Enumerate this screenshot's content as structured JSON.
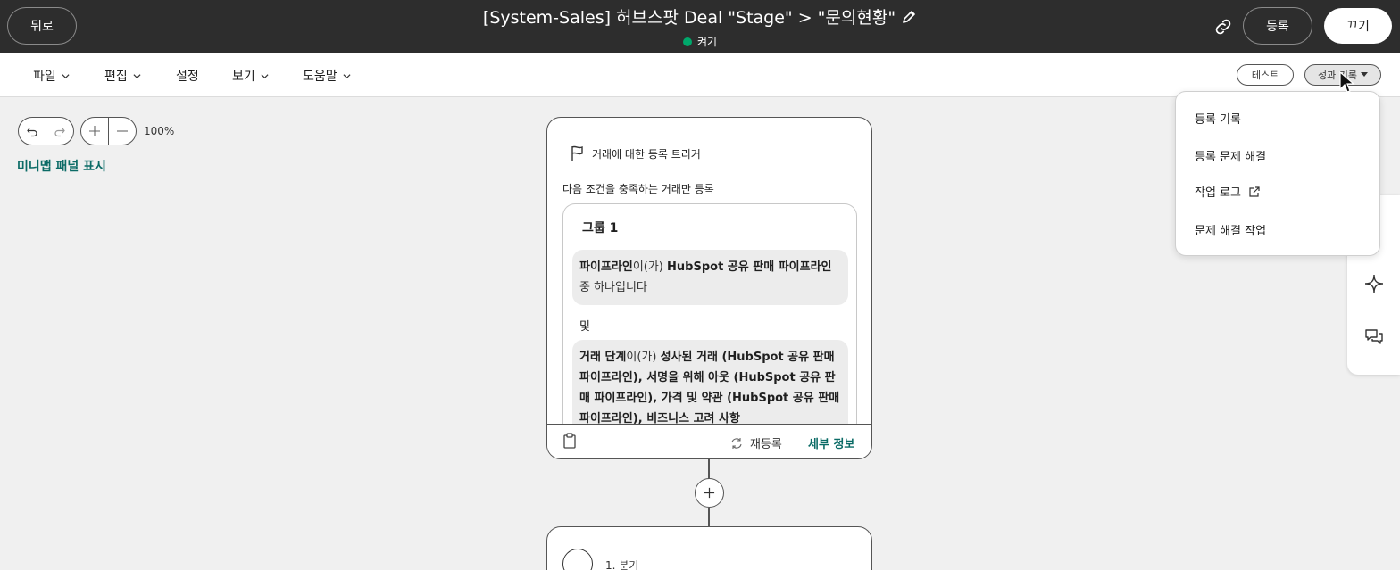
{
  "header": {
    "back_label": "뒤로",
    "title": "[System-Sales] 허브스팟 Deal \"Stage\" > \"문의현황\"",
    "status_text": "켜기",
    "status_color": "#00a86b",
    "register_label": "등록",
    "off_label": "끄기",
    "icons": {
      "edit": "pencil-icon",
      "link": "link-icon"
    }
  },
  "menubar": {
    "items": [
      {
        "label": "파일",
        "has_chevron": true
      },
      {
        "label": "편집",
        "has_chevron": true
      },
      {
        "label": "설정",
        "has_chevron": false
      },
      {
        "label": "보기",
        "has_chevron": true
      },
      {
        "label": "도움말",
        "has_chevron": true
      }
    ],
    "test_label": "테스트",
    "perf_label": "성과 기록"
  },
  "canvas": {
    "zoom": "100%",
    "minimap_label": "미니맵 패널 표시",
    "accent_color": "#0b6b66"
  },
  "trigger_card": {
    "title": "거래에 대한 등록 트리거",
    "subtitle": "다음 조건을 충족하는 거래만 등록",
    "group_title": "그룹 1",
    "cond1": {
      "prop": "파이프라인",
      "op": "이(가)",
      "value": "HubSpot 공유 판매 파이프라인",
      "suffix": "중 하나입니다"
    },
    "and_label": "및",
    "cond2": {
      "prop": "거래 단계",
      "op": "이(가)",
      "values": "성사된 거래 (HubSpot 공유 판매 파이프라인), 서명을 위해 아웃 (HubSpot 공유 판매 파이프라인), 가격 및 약관 (HubSpot 공유 판매 파이프라인), 비즈니스 고려 사항"
    },
    "footer": {
      "reenroll_label": "재등록",
      "details_label": "세부 정보"
    }
  },
  "branch_card": {
    "label": "1. 분기"
  },
  "dropdown": {
    "items": [
      {
        "label": "등록 기록",
        "external": false
      },
      {
        "label": "등록 문제 해결",
        "external": false
      },
      {
        "label": "작업 로그",
        "external": true
      },
      {
        "label": "문제 해결 작업",
        "external": false
      }
    ]
  }
}
